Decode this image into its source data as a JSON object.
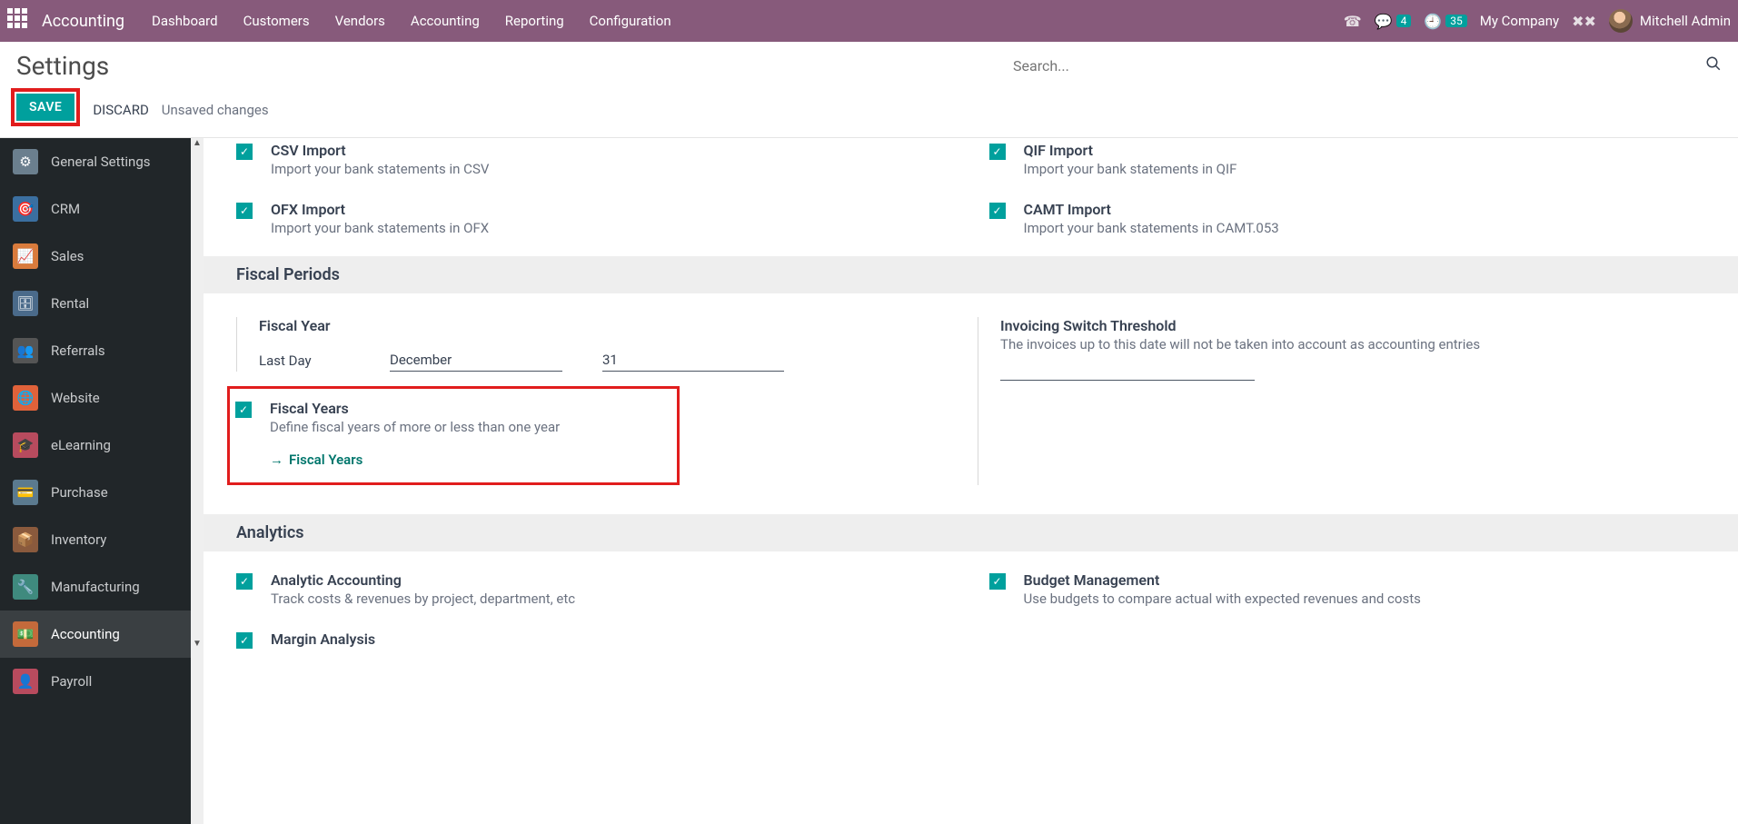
{
  "header": {
    "app": "Accounting",
    "menu": [
      "Dashboard",
      "Customers",
      "Vendors",
      "Accounting",
      "Reporting",
      "Configuration"
    ],
    "chat_badge": "4",
    "activity_badge": "35",
    "company": "My Company",
    "user": "Mitchell Admin"
  },
  "page": {
    "title": "Settings",
    "search_placeholder": "Search...",
    "save": "SAVE",
    "discard": "DISCARD",
    "unsaved": "Unsaved changes"
  },
  "sidebar": [
    {
      "label": "General Settings",
      "color": "#6b7f8e"
    },
    {
      "label": "CRM",
      "color": "#3b6fa0"
    },
    {
      "label": "Sales",
      "color": "#d97b3c"
    },
    {
      "label": "Rental",
      "color": "#4a6a8a"
    },
    {
      "label": "Referrals",
      "color": "#555"
    },
    {
      "label": "Website",
      "color": "#e0623a"
    },
    {
      "label": "eLearning",
      "color": "#b84b5e"
    },
    {
      "label": "Purchase",
      "color": "#5b7a8f"
    },
    {
      "label": "Inventory",
      "color": "#8a5a3d"
    },
    {
      "label": "Manufacturing",
      "color": "#3f8a7e"
    },
    {
      "label": "Accounting",
      "color": "#c46a3b",
      "active": true
    },
    {
      "label": "Payroll",
      "color": "#b84b5e"
    }
  ],
  "imports": {
    "csv": {
      "title": "CSV Import",
      "desc": "Import your bank statements in CSV"
    },
    "qif": {
      "title": "QIF Import",
      "desc": "Import your bank statements in QIF"
    },
    "ofx": {
      "title": "OFX Import",
      "desc": "Import your bank statements in OFX"
    },
    "camt": {
      "title": "CAMT Import",
      "desc": "Import your bank statements in CAMT.053"
    }
  },
  "sections": {
    "fiscal": "Fiscal Periods",
    "analytics": "Analytics"
  },
  "fiscal": {
    "title": "Fiscal Year",
    "lastday": "Last Day",
    "month": "December",
    "day": "31",
    "fy_title": "Fiscal Years",
    "fy_desc": "Define fiscal years of more or less than one year",
    "fy_link": "Fiscal Years",
    "threshold_title": "Invoicing Switch Threshold",
    "threshold_desc": "The invoices up to this date will not be taken into account as accounting entries"
  },
  "analytics": {
    "aa": {
      "title": "Analytic Accounting",
      "desc": "Track costs & revenues by project, department, etc"
    },
    "budget": {
      "title": "Budget Management",
      "desc": "Use budgets to compare actual with expected revenues and costs"
    },
    "margin": {
      "title": "Margin Analysis",
      "desc": ""
    }
  }
}
